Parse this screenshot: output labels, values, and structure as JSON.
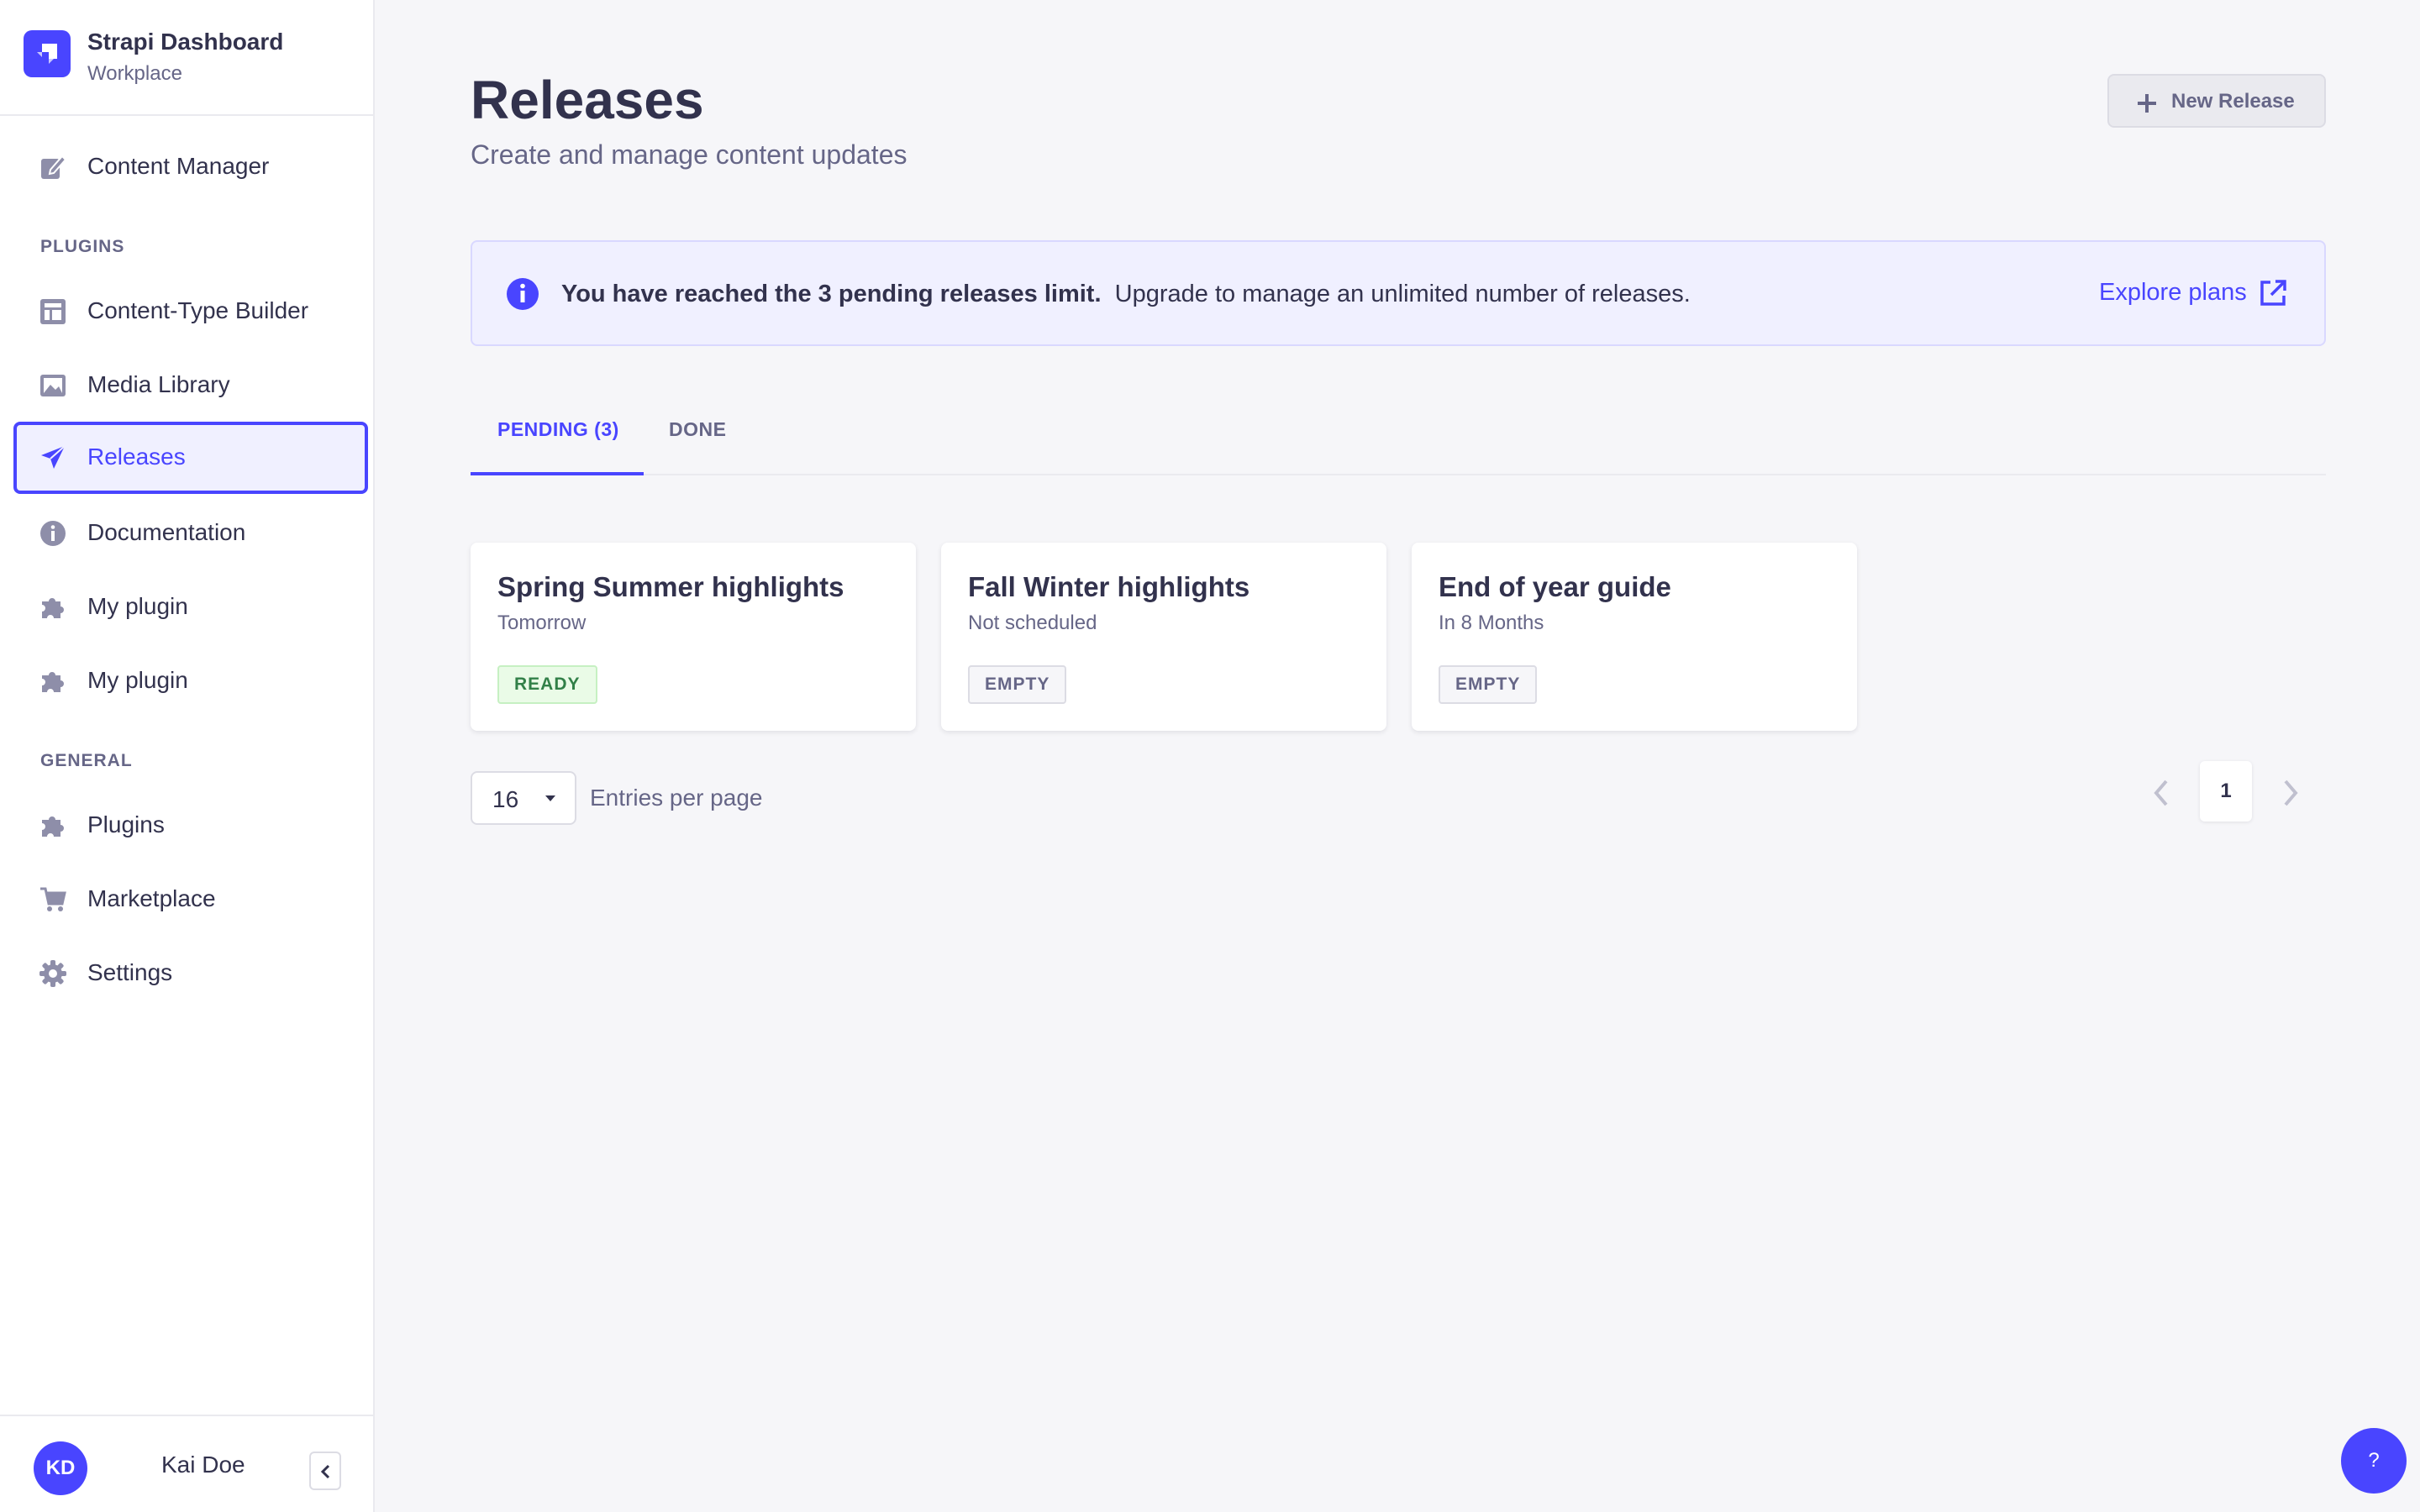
{
  "sidebar": {
    "brand_title": "Strapi Dashboard",
    "brand_subtitle": "Workplace",
    "content_manager": "Content Manager",
    "section_plugins": "PLUGINS",
    "plugins": [
      {
        "label": "Content-Type Builder",
        "icon": "layout-icon"
      },
      {
        "label": "Media Library",
        "icon": "image-icon"
      },
      {
        "label": "Releases",
        "icon": "paper-plane-icon",
        "active": true
      },
      {
        "label": "Documentation",
        "icon": "info-icon"
      },
      {
        "label": "My plugin",
        "icon": "puzzle-icon"
      },
      {
        "label": "My plugin",
        "icon": "puzzle-icon"
      }
    ],
    "section_general": "GENERAL",
    "general": [
      {
        "label": "Plugins",
        "icon": "puzzle-icon"
      },
      {
        "label": "Marketplace",
        "icon": "cart-icon"
      },
      {
        "label": "Settings",
        "icon": "gear-icon"
      }
    ],
    "user": {
      "initials": "KD",
      "name": "Kai Doe"
    }
  },
  "header": {
    "title": "Releases",
    "subtitle": "Create and manage content updates",
    "new_release_label": "New Release"
  },
  "banner": {
    "bold_text": "You have reached the 3 pending releases limit.",
    "text": "Upgrade to manage an unlimited number of releases.",
    "link_label": "Explore plans"
  },
  "tabs": [
    {
      "label": "PENDING (3)",
      "active": true
    },
    {
      "label": "DONE",
      "active": false
    }
  ],
  "releases": [
    {
      "title": "Spring Summer highlights",
      "schedule": "Tomorrow",
      "status": "READY"
    },
    {
      "title": "Fall Winter highlights",
      "schedule": "Not scheduled",
      "status": "EMPTY"
    },
    {
      "title": "End of year guide",
      "schedule": "In 8 Months",
      "status": "EMPTY"
    }
  ],
  "pagination": {
    "per_page_value": "16",
    "per_page_label": "Entries per page",
    "current_page": "1"
  },
  "help_label": "?",
  "colors": {
    "primary": "#4945ff",
    "success_text": "#328048",
    "neutral_text": "#666687",
    "background": "#f6f6f9"
  }
}
